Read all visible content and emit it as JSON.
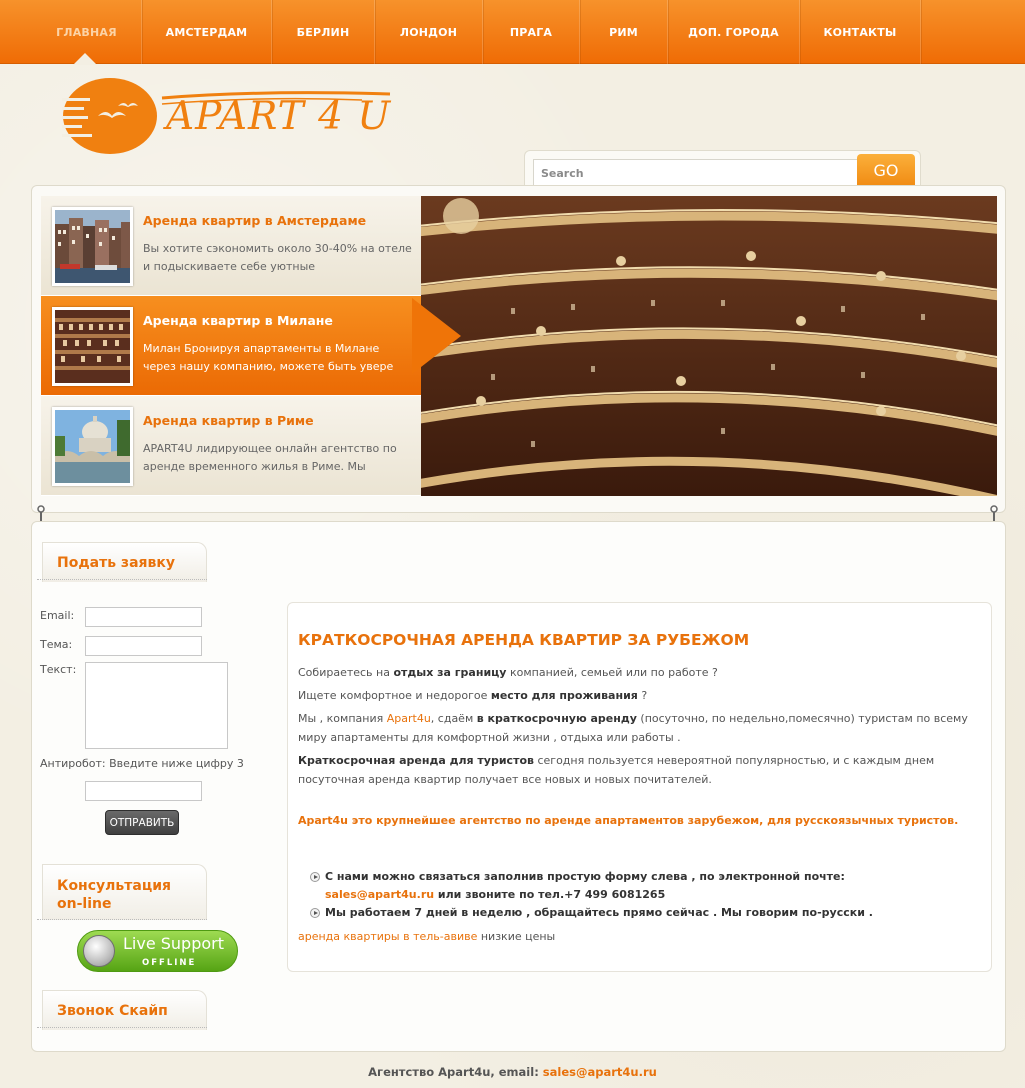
{
  "nav": {
    "items": [
      {
        "label": "ГЛАВНАЯ"
      },
      {
        "label": "АМСТЕРДАМ"
      },
      {
        "label": "БЕРЛИН"
      },
      {
        "label": "ЛОНДОН"
      },
      {
        "label": "ПРАГА"
      },
      {
        "label": "РИМ"
      },
      {
        "label": "ДОП. ГОРОДА"
      },
      {
        "label": "КОНТАКТЫ"
      }
    ],
    "active": "ГЛАВНАЯ"
  },
  "logo": {
    "text": "APART 4 U"
  },
  "search": {
    "placeholder": "Search",
    "button_label": "GO"
  },
  "slider": {
    "items": [
      {
        "title": "Аренда квартир в Амстердаме",
        "text": "Вы хотите сэкономить около 30-40% на отеле и подыскиваете себе уютные"
      },
      {
        "title": "Аренда квартир в Милане",
        "text": "Милан Бронируя апартаменты в Милане через нашу компанию, можете быть увере"
      },
      {
        "title": "Аренда квартир в Риме",
        "text": "APART4U лидирующее онлайн агентство по аренде временного жилья в Риме. Мы"
      }
    ],
    "active_index": 1
  },
  "sidebar": {
    "request": {
      "title": "Подать заявку",
      "email_label": "Email:",
      "subject_label": "Тема:",
      "text_label": "Текст:",
      "antirobot_label": "Антиробот: Введите ниже цифру 3",
      "submit_label": "ОТПРАВИТЬ"
    },
    "consult": {
      "title_line1": "Консультация",
      "title_line2": "on-line"
    },
    "live_support": {
      "title": "Live Support",
      "status": "OFFLINE"
    },
    "skype": {
      "title": "Звонок Скайп"
    }
  },
  "content": {
    "title": "КРАТКОСРОЧНАЯ АРЕНДА КВАРТИР ЗА РУБЕЖОМ",
    "p1": {
      "a": "Собираетесь на ",
      "b": "отдых за границу",
      "c": " компанией, семьей или по работе ?"
    },
    "p2": {
      "a": "Ищете комфортное и недорогое ",
      "b": "место для проживания",
      "c": " ?"
    },
    "p3": {
      "a": "Мы , компания ",
      "link": "Apart4u",
      "b": ", сдаём ",
      "bold": "в краткосрочную аренду",
      "c": " (посуточно, по недельно,помесячно) туристам по всему миру апартаменты для комфортной жизни , отдыха или работы ."
    },
    "p4": {
      "bold": "Краткосрочная аренда для туристов",
      "c": " сегодня пользуется невероятной популярностью, и с каждым днем посуточная аренда квартир получает все новых и новых почитателей."
    },
    "highlight": "Apart4u это крупнейшее агентство по аренде апартаментов зарубежом, для русскоязычных туристов.",
    "bullet1": {
      "a": "С нами можно связаться заполнив простую форму слева , по электронной почте:",
      "email": "sales@apart4u.ru",
      "b": " или звоните по тел.+7 499 6081265"
    },
    "bullet2": "Мы работаем 7 дней в неделю , обращайтесь прямо сейчас . Мы говорим по-русски .",
    "last": {
      "link": "аренда квартиры в тель-авиве",
      "rest": " низкие цены"
    }
  },
  "footer": {
    "text": "Агентство Apart4u, email: ",
    "email": "sales@apart4u.ru"
  },
  "colors": {
    "accent": "#ef7408",
    "nav_bg": "#f58420",
    "text": "#555555",
    "live_support": "#7cc434"
  }
}
